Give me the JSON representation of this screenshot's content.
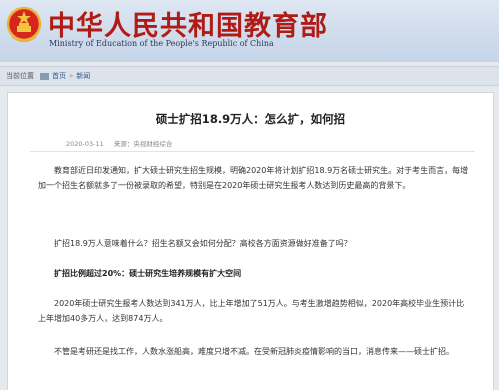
{
  "header": {
    "title": "中华人民共和国教育部",
    "subtitle": "Ministry of Education of the People's Republic of China",
    "colors": {
      "title": "#b01b16",
      "band": "#cfdcec"
    }
  },
  "breadcrumb": {
    "label": "当前位置",
    "home": "首页",
    "current": "新闻"
  },
  "article": {
    "title": "硕士扩招18.9万人：怎么扩，如何招",
    "date": "2020-03-11",
    "source": "来源：央视财经综合",
    "paragraphs": [
      "教育部近日印发通知，扩大硕士研究生招生规模，明确2020年将计划扩招18.9万名硕士研究生。对于考生而言，每增加一个招生名额就多了一份被录取的希望，特别是在2020年硕士研究生报考人数达到历史最高的背景下。",
      "扩招18.9万人意味着什么？招生名额又会如何分配？高校各方面资源做好准备了吗？",
      "扩招比例超过20%：硕士研究生培养规模有扩大空间",
      "2020年硕士研究生报考人数达到341万人，比上年增加了51万人。与考生激增趋势相似，2020年高校毕业生预计比上年增加40多万人，达到874万人。",
      "不管是考研还是找工作，人数水涨船高，难度只增不减。在受新冠肺炎疫情影响的当口，消息传来——硕士扩招。"
    ]
  }
}
